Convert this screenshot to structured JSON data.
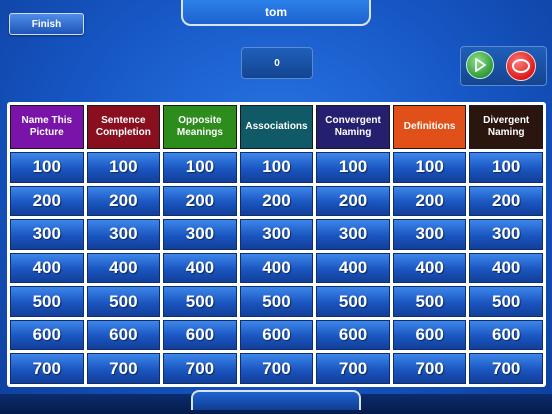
{
  "header": {
    "player_name": "tom",
    "finish_label": "Finish",
    "score": "0"
  },
  "controls": {
    "play_icon": "play-triangle-icon",
    "stop_icon": "stop-ring-icon"
  },
  "categories": [
    {
      "label": "Name This Picture",
      "color": "#7a14a8"
    },
    {
      "label": "Sentence Completion",
      "color": "#8a0f1e"
    },
    {
      "label": "Opposite Meanings",
      "color": "#2c8c1c"
    },
    {
      "label": "Associations",
      "color": "#0f5a66"
    },
    {
      "label": "Convergent Naming",
      "color": "#241f6e"
    },
    {
      "label": "Definitions",
      "color": "#e2501a"
    },
    {
      "label": "Divergent Naming",
      "color": "#2a160f"
    }
  ],
  "values": [
    "100",
    "200",
    "300",
    "400",
    "500",
    "600",
    "700"
  ]
}
